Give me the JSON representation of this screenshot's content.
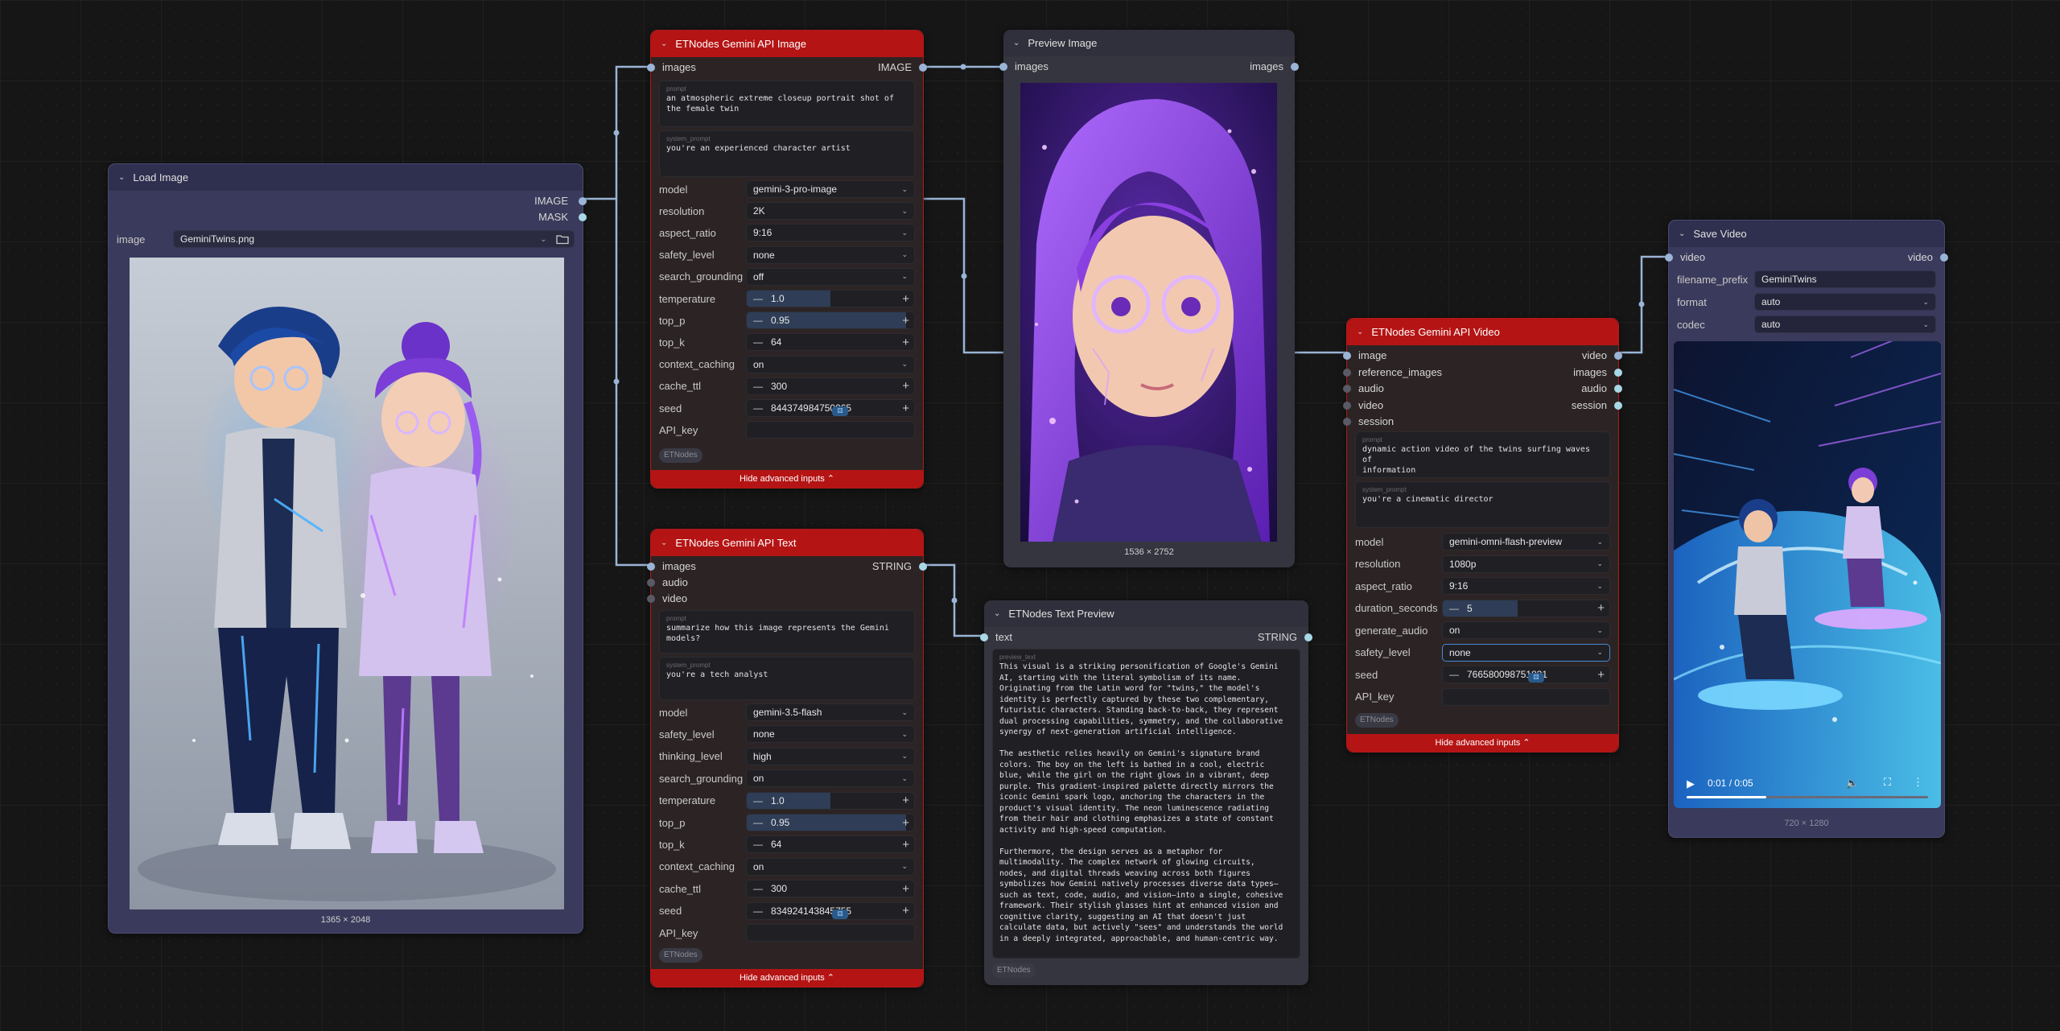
{
  "load_image": {
    "title": "Load Image",
    "outputs": [
      "IMAGE",
      "MASK"
    ],
    "image_label": "image",
    "image_value": "GeminiTwins.png",
    "dims": "1365 × 2048"
  },
  "gemini_image": {
    "title": "ETNodes Gemini API Image",
    "input": "images",
    "output": "IMAGE",
    "prompt_ph": "prompt",
    "prompt": "an atmospheric extreme closeup portrait shot of\nthe female twin",
    "system_ph": "system_prompt",
    "system_prompt": "you're an experienced character artist",
    "widgets": [
      {
        "label": "model",
        "value": "gemini-3-pro-image"
      },
      {
        "label": "resolution",
        "value": "2K"
      },
      {
        "label": "aspect_ratio",
        "value": "9:16"
      },
      {
        "label": "safety_level",
        "value": "none"
      },
      {
        "label": "search_grounding",
        "value": "off"
      },
      {
        "label": "temperature",
        "value": "1.0"
      },
      {
        "label": "top_p",
        "value": "0.95"
      },
      {
        "label": "top_k",
        "value": "64"
      },
      {
        "label": "context_caching",
        "value": "on"
      },
      {
        "label": "cache_ttl",
        "value": "300"
      },
      {
        "label": "seed",
        "value": "844374984750065"
      },
      {
        "label": "API_key",
        "value": ""
      }
    ],
    "tag": "ETNodes",
    "hide": "Hide advanced inputs"
  },
  "gemini_text": {
    "title": "ETNodes Gemini API Text",
    "inputs": [
      "images",
      "audio",
      "video"
    ],
    "output": "STRING",
    "prompt_ph": "prompt",
    "prompt": "summarize how this image represents the Gemini\nmodels?",
    "system_ph": "system_prompt",
    "system_prompt": "you're a tech analyst",
    "widgets": [
      {
        "label": "model",
        "value": "gemini-3.5-flash"
      },
      {
        "label": "safety_level",
        "value": "none"
      },
      {
        "label": "thinking_level",
        "value": "high"
      },
      {
        "label": "search_grounding",
        "value": "on"
      },
      {
        "label": "temperature",
        "value": "1.0"
      },
      {
        "label": "top_p",
        "value": "0.95"
      },
      {
        "label": "top_k",
        "value": "64"
      },
      {
        "label": "context_caching",
        "value": "on"
      },
      {
        "label": "cache_ttl",
        "value": "300"
      },
      {
        "label": "seed",
        "value": "834924143845755"
      },
      {
        "label": "API_key",
        "value": ""
      }
    ],
    "tag": "ETNodes",
    "hide": "Hide advanced inputs"
  },
  "preview_image": {
    "title": "Preview Image",
    "input": "images",
    "output": "images",
    "dims": "1536 × 2752"
  },
  "text_preview": {
    "title": "ETNodes Text Preview",
    "input": "text",
    "output": "STRING",
    "ph": "preview_text",
    "text": "This visual is a striking personification of Google's Gemini\nAI, starting with the literal symbolism of its name.\nOriginating from the Latin word for \"twins,\" the model's\nidentity is perfectly captured by these two complementary,\nfuturistic characters. Standing back-to-back, they represent\ndual processing capabilities, symmetry, and the collaborative\nsynergy of next-generation artificial intelligence.\n\nThe aesthetic relies heavily on Gemini's signature brand\ncolors. The boy on the left is bathed in a cool, electric\nblue, while the girl on the right glows in a vibrant, deep\npurple. This gradient-inspired palette directly mirrors the\niconic Gemini spark logo, anchoring the characters in the\nproduct's visual identity. The neon luminescence radiating\nfrom their hair and clothing emphasizes a state of constant\nactivity and high-speed computation.\n\nFurthermore, the design serves as a metaphor for\nmultimodality. The complex network of glowing circuits,\nnodes, and digital threads weaving across both figures\nsymbolizes how Gemini natively processes diverse data types—\nsuch as text, code, audio, and vision—into a single, cohesive\nframework. Their stylish glasses hint at enhanced vision and\ncognitive clarity, suggesting an AI that doesn't just\ncalculate data, but actively \"sees\" and understands the world\nin a deeply integrated, approachable, and human-centric way.",
    "tag": "ETNodes"
  },
  "gemini_video": {
    "title": "ETNodes Gemini API Video",
    "inputs": [
      "image",
      "reference_images",
      "audio",
      "video",
      "session"
    ],
    "outputs": [
      "video",
      "images",
      "audio",
      "session"
    ],
    "prompt_ph": "prompt",
    "prompt": "dynamic action video of the twins surfing waves of\ninformation",
    "system_ph": "system_prompt",
    "system_prompt": "you're a cinematic director",
    "widgets": [
      {
        "label": "model",
        "value": "gemini-omni-flash-preview"
      },
      {
        "label": "resolution",
        "value": "1080p"
      },
      {
        "label": "aspect_ratio",
        "value": "9:16"
      },
      {
        "label": "duration_seconds",
        "value": "5"
      },
      {
        "label": "generate_audio",
        "value": "on"
      },
      {
        "label": "safety_level",
        "value": "none"
      },
      {
        "label": "seed",
        "value": "766580098751831"
      },
      {
        "label": "API_key",
        "value": ""
      }
    ],
    "tag": "ETNodes",
    "hide": "Hide advanced inputs"
  },
  "save_video": {
    "title": "Save Video",
    "input": "video",
    "output": "video",
    "widgets": [
      {
        "label": "filename_prefix",
        "value": "GeminiTwins"
      },
      {
        "label": "format",
        "value": "auto"
      },
      {
        "label": "codec",
        "value": "auto"
      }
    ],
    "time": "0:01 / 0:05",
    "progress": 0.33,
    "dims": "720 × 1280"
  },
  "colors": {
    "red_header": "#b51414",
    "blue_node": "#3a3a5c",
    "wire": "#9ab4d6",
    "purple_glow": "#a05cff",
    "blue_glow": "#2e8bff"
  },
  "icons": [
    "chevron-down-icon",
    "folder-icon",
    "play-icon",
    "volume-icon",
    "fullscreen-icon",
    "more-icon",
    "dice-icon"
  ]
}
